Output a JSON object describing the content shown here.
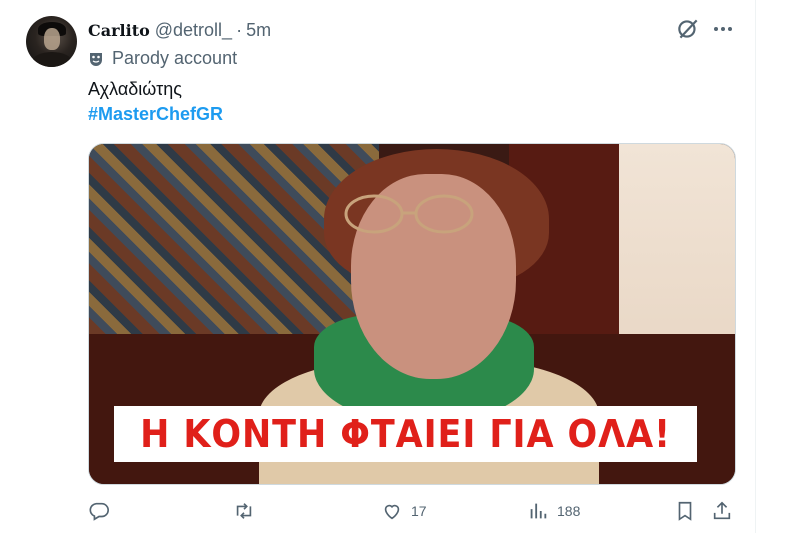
{
  "tweet": {
    "display_name": "Carlito",
    "handle": "@detroll_",
    "separator": "·",
    "time": "5m",
    "label": "Parody account",
    "text": "Αχλαδιώτης",
    "hashtag": "#MasterChefGR",
    "image_caption": "Η ΚΟΝΤΗ ΦΤΑΙΕΙ ΓΙΑ ΟΛΑ!"
  },
  "actions": {
    "reply_count": "",
    "retweet_count": "",
    "like_count": "17",
    "views_count": "188"
  },
  "icons": {
    "grok": "grok-icon",
    "more": "more-icon",
    "parody": "mask-icon",
    "reply": "reply-icon",
    "retweet": "retweet-icon",
    "like": "heart-icon",
    "views": "views-icon",
    "bookmark": "bookmark-icon",
    "share": "share-icon"
  },
  "colors": {
    "link": "#1d9bf0",
    "muted": "#536471",
    "caption_red": "#e0201a"
  }
}
